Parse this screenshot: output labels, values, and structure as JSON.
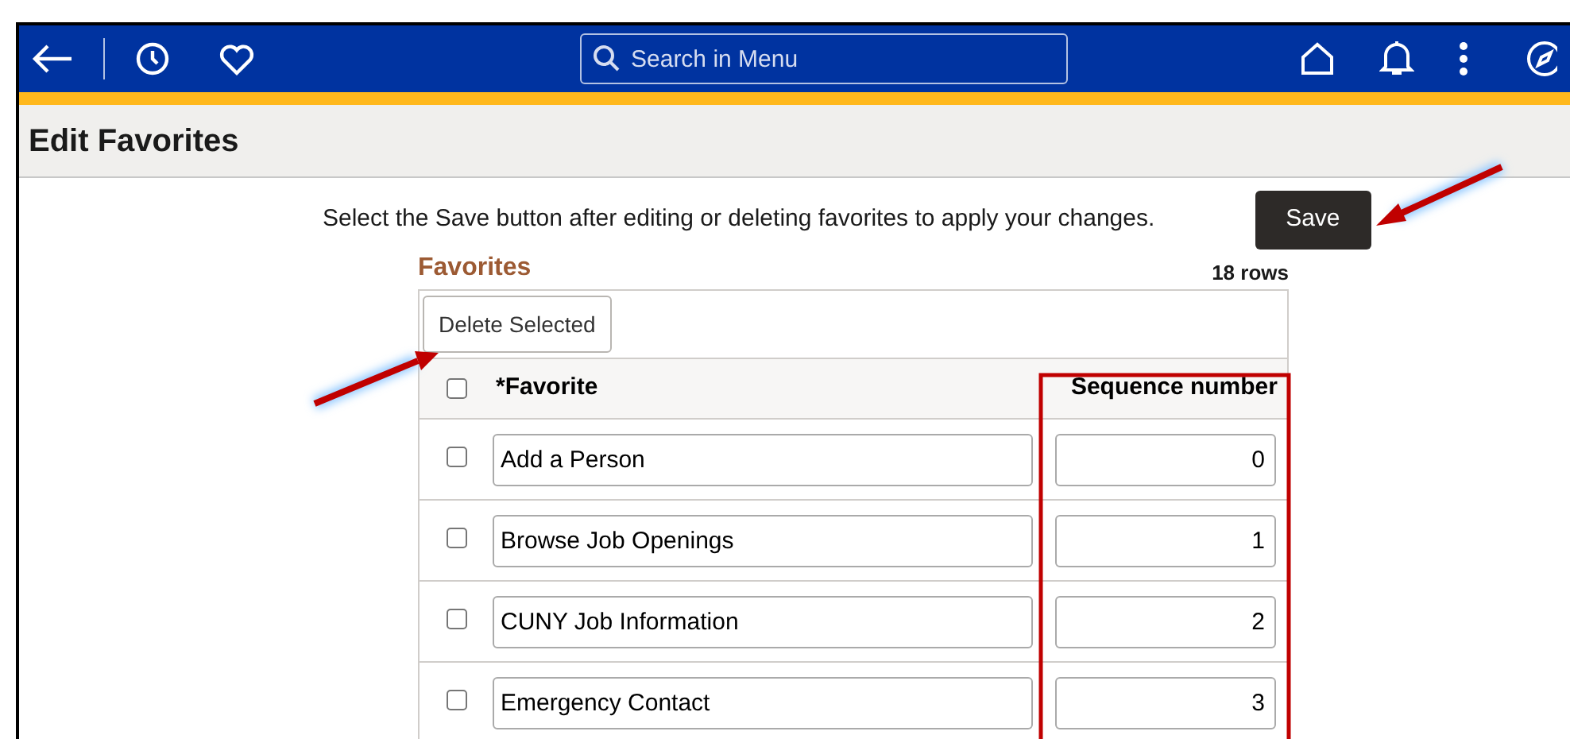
{
  "header": {
    "search": {
      "placeholder": "Search in Menu"
    }
  },
  "page_title": "Edit Favorites",
  "instruction": "Select the Save button after editing or deleting favorites to apply your changes.",
  "save_button": "Save",
  "grid": {
    "title": "Favorites",
    "row_count": "18 rows",
    "delete_button": "Delete Selected",
    "columns": [
      {
        "label": "*Favorite"
      },
      {
        "label": "Sequence number"
      }
    ],
    "select_all": {
      "checked": false
    },
    "rows": [
      {
        "checked": false,
        "favorite": "Add a Person",
        "sequence": "0"
      },
      {
        "checked": false,
        "favorite": "Browse Job Openings",
        "sequence": "1"
      },
      {
        "checked": false,
        "favorite": "CUNY Job Information",
        "sequence": "2"
      },
      {
        "checked": false,
        "favorite": "Emergency Contact",
        "sequence": "3"
      }
    ]
  }
}
